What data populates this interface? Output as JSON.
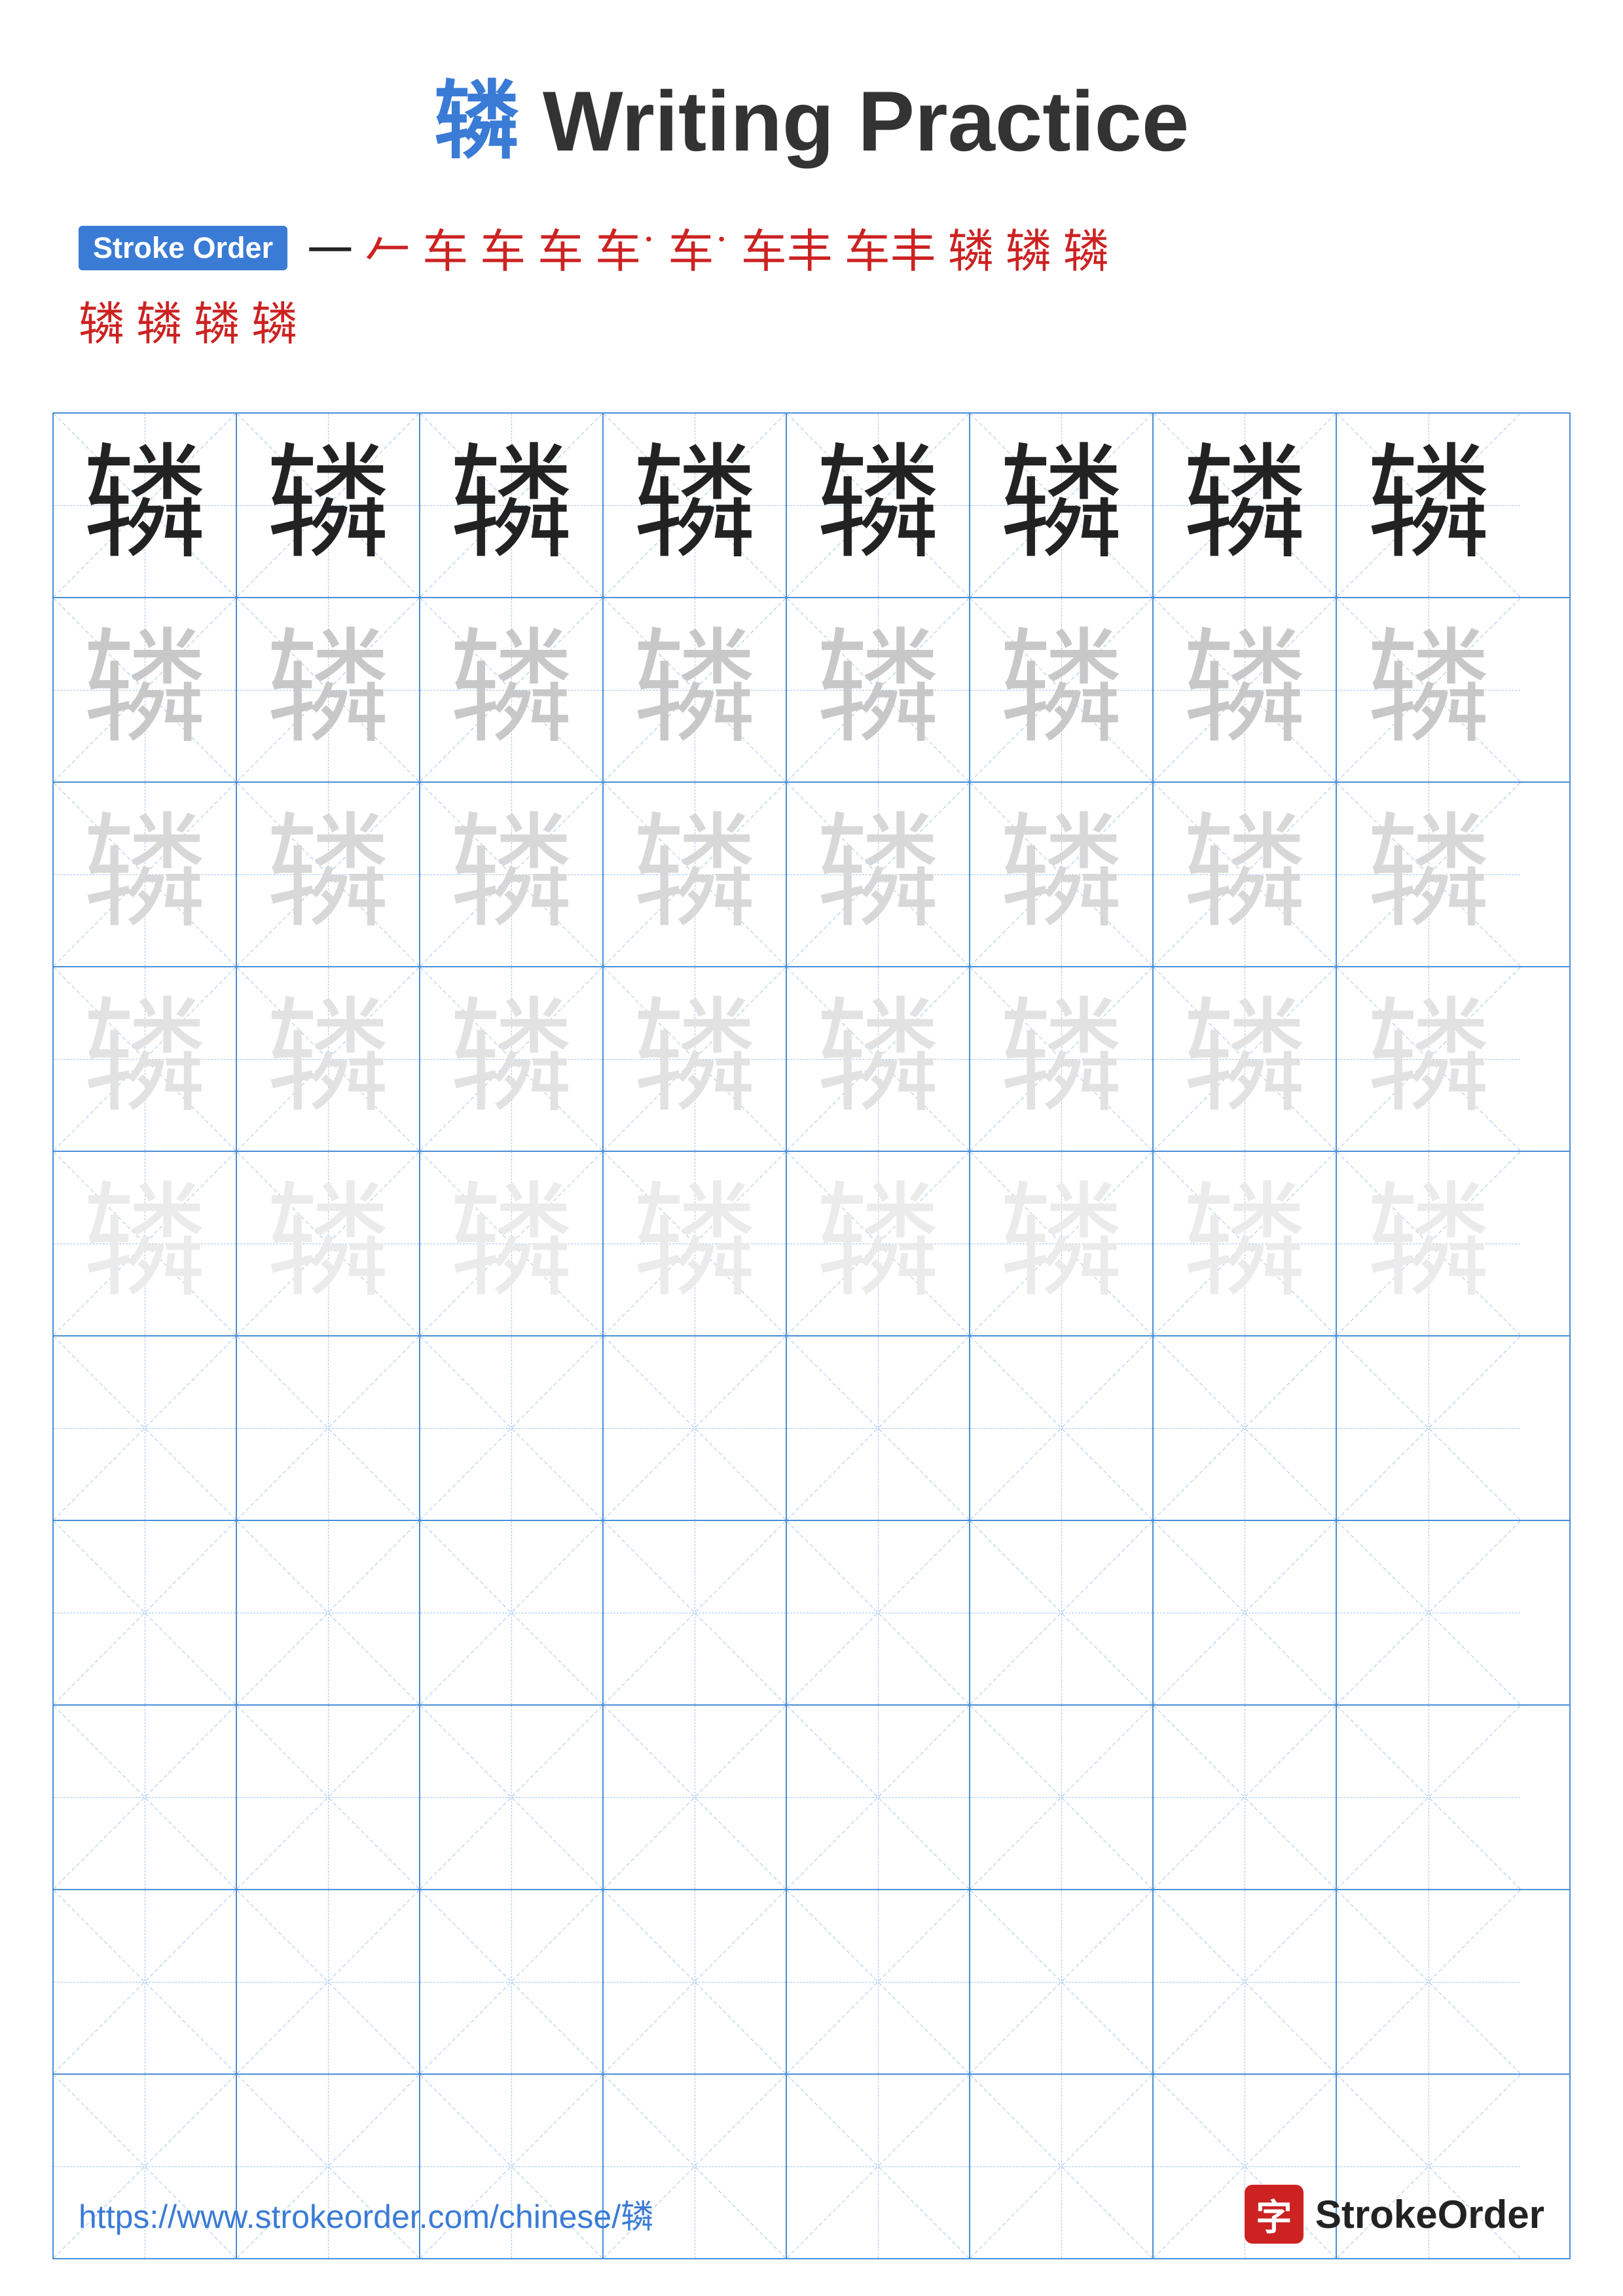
{
  "header": {
    "chinese_char": "辚",
    "title": " Writing Practice"
  },
  "stroke_order": {
    "badge_label": "Stroke Order",
    "strokes": [
      "一",
      "𠂉",
      "车",
      "车",
      "车",
      "车˙",
      "车˙",
      "车丰",
      "车丰",
      "辚",
      "辚",
      "辚",
      "辚",
      "辚",
      "辚",
      "辚"
    ],
    "row2_chars": [
      "辚",
      "辚",
      "辚",
      "辚"
    ]
  },
  "grid": {
    "rows": 10,
    "cols": 8,
    "practice_char": "辚",
    "row_types": [
      "dark",
      "medium",
      "light",
      "lighter",
      "lightest",
      "empty",
      "empty",
      "empty",
      "empty",
      "empty"
    ]
  },
  "footer": {
    "url": "https://www.strokeorder.com/chinese/辚",
    "brand_char": "字",
    "brand_name": "StrokeOrder"
  }
}
